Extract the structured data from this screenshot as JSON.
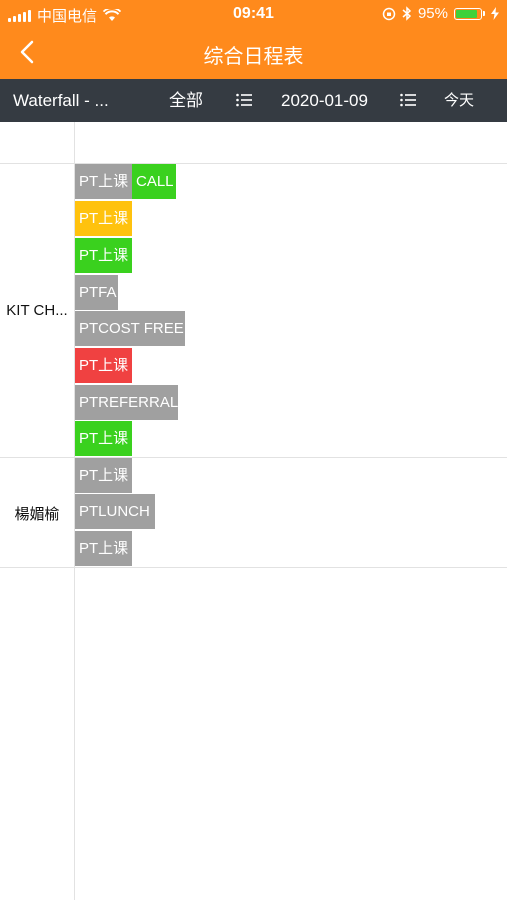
{
  "status_bar": {
    "carrier": "中国电信",
    "time": "09:41",
    "battery": "95%",
    "battery_level": 0.95,
    "icons": [
      "signal-icon",
      "wifi-icon",
      "orientation-lock-icon",
      "bluetooth-icon",
      "battery-icon",
      "charging-icon"
    ]
  },
  "nav": {
    "title": "综合日程表",
    "back_icon": "chevron-left-icon"
  },
  "toolbar": {
    "project": "Waterfall - ...",
    "filter": "全部",
    "date": "2020-01-09",
    "today": "今天",
    "list_icon": "list-icon"
  },
  "colors": {
    "header": "#FF8A1C",
    "toolbar": "#353B42",
    "event_gray": "#A0A0A0",
    "event_yellow": "#FFC20E",
    "event_green": "#3AD11E",
    "event_red": "#F04141"
  },
  "schedule": [
    {
      "name": "KIT CH...",
      "events": [
        {
          "label": "PT上课",
          "color": "gray"
        },
        {
          "label": "CALL",
          "color": "green"
        },
        {
          "label": "PT上课",
          "color": "yellow"
        },
        {
          "label": "PT上课",
          "color": "green"
        },
        {
          "label": "PTFA",
          "color": "gray"
        },
        {
          "label": "PTCOST FREE",
          "color": "gray"
        },
        {
          "label": "PT上课",
          "color": "red"
        },
        {
          "label": "PTREFERRAL",
          "color": "gray"
        },
        {
          "label": "PT上课",
          "color": "green"
        }
      ]
    },
    {
      "name": "楊媚榆",
      "events": [
        {
          "label": "PT上课",
          "color": "gray"
        },
        {
          "label": "PTLUNCH",
          "color": "gray"
        },
        {
          "label": "PT上课",
          "color": "gray"
        }
      ]
    }
  ]
}
